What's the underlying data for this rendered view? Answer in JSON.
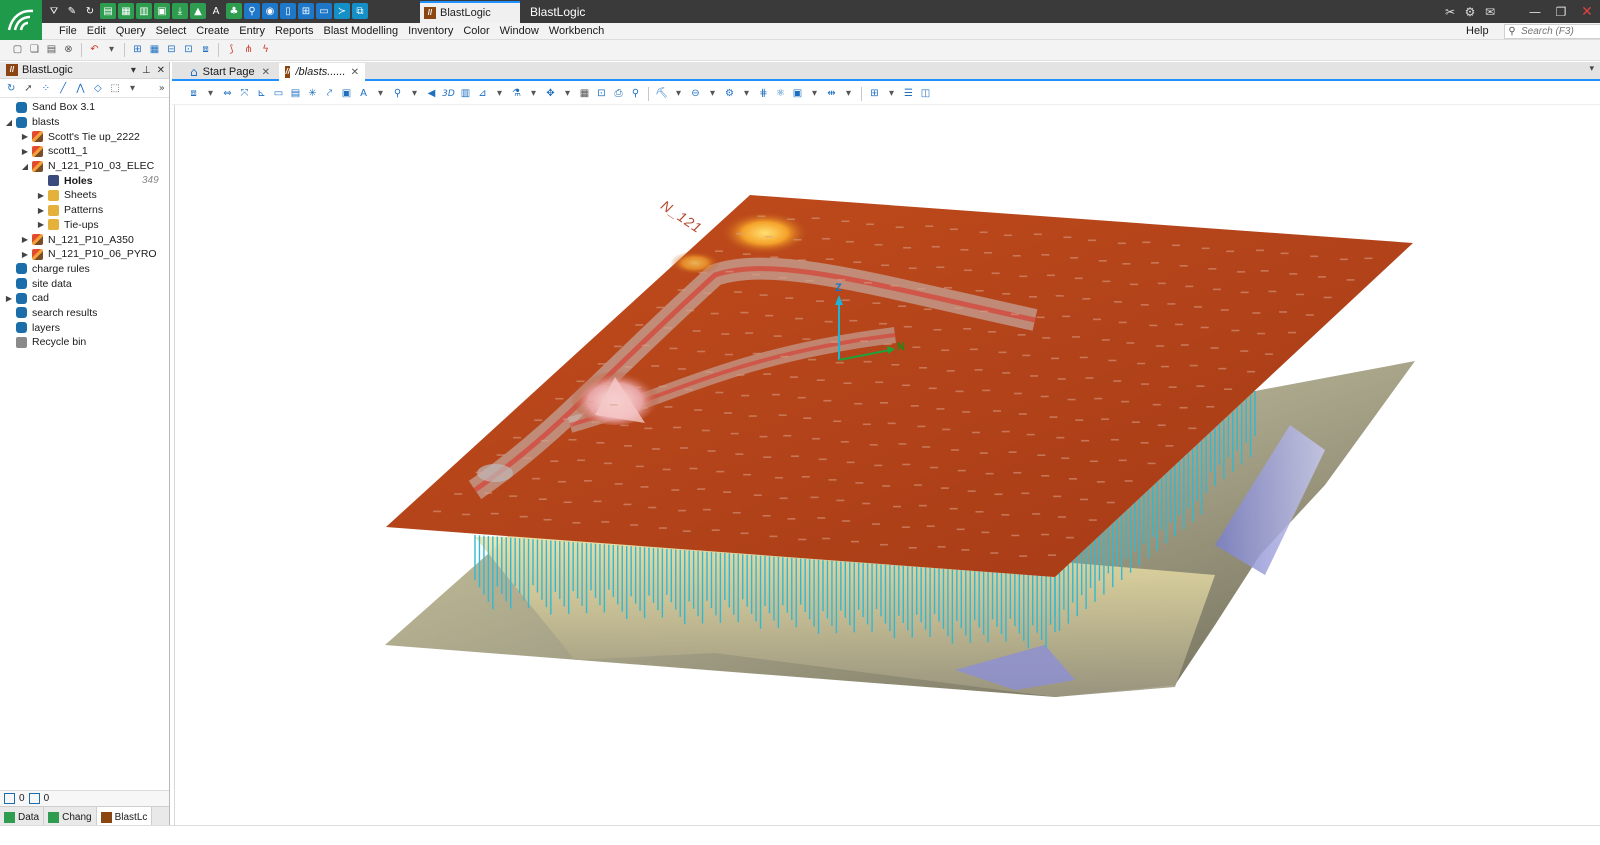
{
  "window": {
    "app_name": "BlastLogic",
    "active_doc_tab": "BlastLogic"
  },
  "menu": {
    "items": [
      "File",
      "Edit",
      "Query",
      "Select",
      "Create",
      "Entry",
      "Reports",
      "Blast Modelling",
      "Inventory",
      "Color",
      "Window",
      "Workbench"
    ],
    "help": "Help",
    "search_placeholder": "Search (F3)"
  },
  "left_panel": {
    "title": "BlastLogic",
    "tree": [
      {
        "label": "Sand Box 3.1",
        "level": 0,
        "toggle": "",
        "icon": "db"
      },
      {
        "label": "blasts",
        "level": 0,
        "toggle": "expanded",
        "icon": "db"
      },
      {
        "label": "Scott's Tie up_2222",
        "level": 1,
        "toggle": "collapsed",
        "icon": "blast"
      },
      {
        "label": "scott1_1",
        "level": 1,
        "toggle": "collapsed",
        "icon": "blast"
      },
      {
        "label": "N_121_P10_03_ELEC",
        "level": 1,
        "toggle": "expanded",
        "icon": "blast"
      },
      {
        "label": "Holes",
        "level": 2,
        "toggle": "",
        "icon": "holes",
        "count": "349",
        "bold": true
      },
      {
        "label": "Sheets",
        "level": 2,
        "toggle": "collapsed",
        "icon": "box"
      },
      {
        "label": "Patterns",
        "level": 2,
        "toggle": "collapsed",
        "icon": "box"
      },
      {
        "label": "Tie-ups",
        "level": 2,
        "toggle": "collapsed",
        "icon": "box"
      },
      {
        "label": "N_121_P10_A350",
        "level": 1,
        "toggle": "collapsed",
        "icon": "blast"
      },
      {
        "label": "N_121_P10_06_PYRO",
        "level": 1,
        "toggle": "collapsed",
        "icon": "blast"
      },
      {
        "label": "charge rules",
        "level": 0,
        "toggle": "",
        "icon": "db"
      },
      {
        "label": "site data",
        "level": 0,
        "toggle": "",
        "icon": "db"
      },
      {
        "label": "cad",
        "level": 0,
        "toggle": "collapsed",
        "icon": "db"
      },
      {
        "label": "search results",
        "level": 0,
        "toggle": "",
        "icon": "db"
      },
      {
        "label": "layers",
        "level": 0,
        "toggle": "",
        "icon": "db"
      },
      {
        "label": "Recycle bin",
        "level": 0,
        "toggle": "",
        "icon": "bin"
      }
    ],
    "status_count_1": "0",
    "status_count_2": "0",
    "bottom_tabs": [
      "Data",
      "Chang",
      "BlastLc"
    ]
  },
  "doc_tabs": {
    "start_page": "Start Page",
    "blasts": "/blasts......"
  },
  "viewport": {
    "north_label": "N_121",
    "axis_z": "Z",
    "axis_n": "N"
  },
  "colors": {
    "title_bar": "#3a3a3a",
    "logo_bg": "#1f9a4a",
    "accent": "#1e90ff",
    "surface": "#b44418",
    "hole_lines": "#2fb9d3"
  }
}
